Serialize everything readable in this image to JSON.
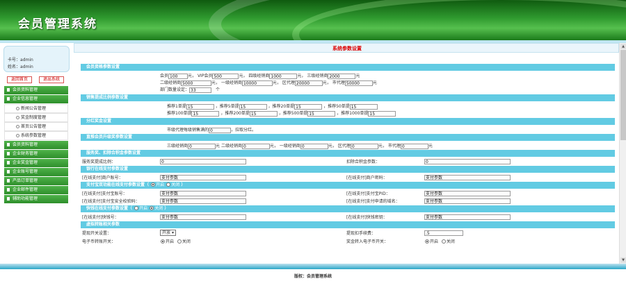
{
  "app": {
    "title": "会员管理系统",
    "footer": "版权：会员管理系统"
  },
  "user": {
    "card_label": "卡号：",
    "card_value": "admin",
    "name_label": "姓名：",
    "name_value": "admin"
  },
  "top_buttons": {
    "home": "返回首页",
    "logout": "退出系统"
  },
  "sidebar": {
    "menu1": "会员资料管理",
    "menu2": "企业信息管理",
    "sub1": "新闻公告管理",
    "sub2": "奖金制度管理",
    "sub3": "首页公告管理",
    "sub4": "系统参数管理",
    "menu3": "会员资料管理",
    "menu4": "企业财务管理",
    "menu5": "企业奖金管理",
    "menu6": "企业账号管理",
    "menu7": "产品订单管理",
    "menu8": "企业邮件管理",
    "menu9": "辅助功能管理"
  },
  "page": {
    "title": "系统参数设置"
  },
  "sec_basic": {
    "header": "会员资格参数设置",
    "member_label": "会员",
    "member_value": "100",
    "member_unit": "元，",
    "vip_label": "VIP会员",
    "vip_value": "500",
    "vip_unit": "元，",
    "dist4_label": "四级经销商",
    "dist4_value": "1000",
    "dist4_unit": "元，",
    "dist3_label": "三级经销商",
    "dist3_value": "2000",
    "dist3_unit": "元",
    "dist2_label": "二级经销商",
    "dist2_value": "5000",
    "dist2_unit": "元，",
    "dist1_label": "一级经销商",
    "dist1_value": "10000",
    "dist1_unit": "元，",
    "region_label": "区代理",
    "region_value": "20000",
    "region_unit": "元，",
    "city_label": "市代理",
    "city_value": "50000",
    "city_unit": "元",
    "dept_label": "部门数量设定：",
    "dept_value": "33",
    "dept_unit": "个"
  },
  "sec_sales": {
    "header": "销售提成比例参数设置",
    "r1c1_label": "推荐1单提",
    "r1c1_value": "15",
    "r1c2_label": "，推荐5单提",
    "r1c2_value": "15",
    "r1c3_label": "，推荐20单提",
    "r1c3_value": "15",
    "r1c4_label": "，推荐50单提",
    "r1c4_value": "15",
    "r2c1_label": "推荐100单提",
    "r2c1_value": "15",
    "r2c2_label": "，推荐200单提",
    "r2c2_value": "15",
    "r2c3_label": "，推荐500单提",
    "r2c3_value": "15",
    "r2c4_label": "，推荐1000单提",
    "r2c4_value": "15"
  },
  "sec_bonus": {
    "header": "分红奖金设置",
    "label": "市级代理每级销售满的",
    "value": "0",
    "unit": "，拉取分红。"
  },
  "sec_direct": {
    "header": "直推会员升级奖参数设置",
    "d3_label": "三级经销商",
    "d3_value": "0",
    "d3_unit": "元",
    "d2_label": "二级经销商",
    "d2_value": "0",
    "d2_unit": "元，",
    "d1_label": "一级经销商",
    "d1_value": "0",
    "d1_unit": "元，",
    "region_label": "区代理",
    "region_value": "0",
    "region_unit": "元，",
    "city_label": "市代理",
    "city_value": "0",
    "city_unit": "元"
  },
  "sec_service": {
    "header": "服务奖、扣除合积金参数设置",
    "service_label": "服务奖提成比例：",
    "service_value": "0",
    "deduct_label": "扣除合积金参数：",
    "deduct_value": "0"
  },
  "sec_pay1": {
    "header": "银行在线支付参数设置",
    "merchant_label": "[在线支付]商户账号：",
    "merchant_value": "支付参数",
    "key_label": "[在线支付]商户密码：",
    "key_value": "支付参数"
  },
  "sec_pay2": {
    "header": "支付宝双功能在线支付参数设置（",
    "on_label": "开启",
    "off_label": "关闭",
    "close_paren": "）",
    "acct_label": "[在线支付]支付宝账号：",
    "acct_value": "支付参数",
    "pid_label": "[在线支付]支付宝PID：",
    "pid_value": "支付参数",
    "secure_label": "[在线支付]支付宝安全校验码：",
    "secure_value": "支付参数",
    "domain_label": "[在线支付]支付申请的域名：",
    "domain_value": "支付参数"
  },
  "sec_pay3": {
    "header": "快钱在线支付参数设置（",
    "on_label": "开启",
    "off_label": "关闭",
    "close_paren": "）",
    "id_label": "[在线支付]快钱号：",
    "id_value": "支付参数",
    "key_label": "[在线支付]快钱密钥：",
    "key_value": "支付参数"
  },
  "sec_transfer": {
    "header": "虚拟转账相关参数",
    "switch_label": "提现开关设置：",
    "switch_value": "开放",
    "fee_label": "提现扣手续费：",
    "fee_value": ".5",
    "ecoin_label": "电子币转账开关：",
    "ecoin_on": "开启",
    "ecoin_off": "关闭",
    "bonus_label": "奖金转入电子币开关：",
    "bonus_on": "开启",
    "bonus_off": "关闭"
  },
  "colors": {
    "section_header": "#62cbe3",
    "menu_green": "#3ea23a",
    "title_red": "#d00000"
  }
}
